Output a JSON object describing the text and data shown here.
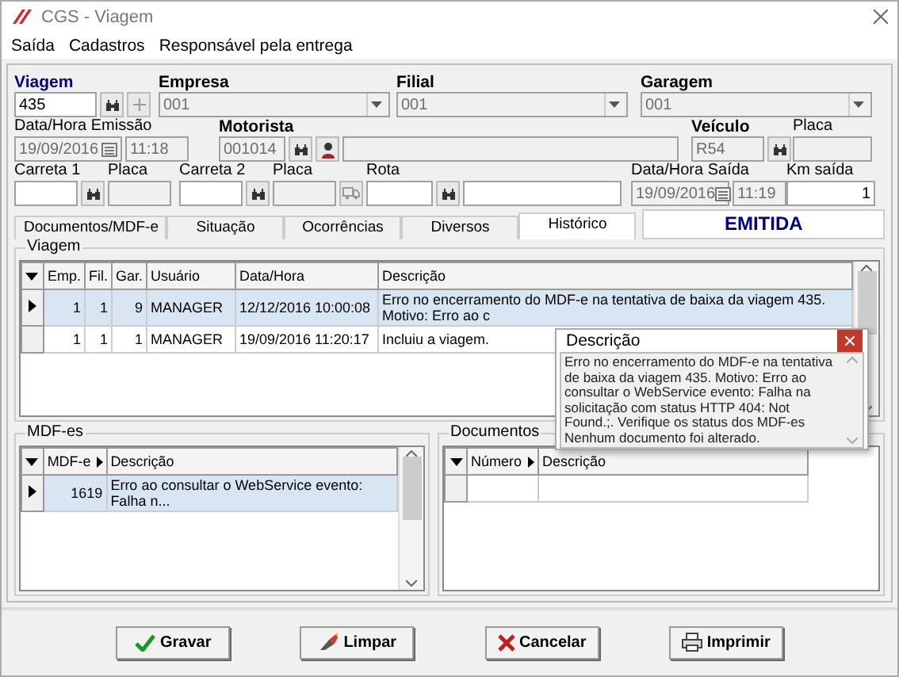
{
  "window": {
    "title": "CGS - Viagem"
  },
  "menu": [
    "Saída",
    "Cadastros",
    "Responsável pela entrega"
  ],
  "form": {
    "viagem": {
      "label": "Viagem",
      "value": "435",
      "disabled": false
    },
    "empresa": {
      "label": "Empresa",
      "value": "001",
      "disabled": true
    },
    "filial": {
      "label": "Filial",
      "value": "001",
      "disabled": true
    },
    "garagem": {
      "label": "Garagem",
      "value": "001",
      "disabled": true
    },
    "emissao": {
      "label": "Data/Hora Emissão",
      "date": "19/09/2016",
      "time": "11:18",
      "disabled": true
    },
    "motorista": {
      "label": "Motorista",
      "value": "001014",
      "disabled": true
    },
    "veiculo": {
      "label": "Veículo",
      "value": "R54",
      "disabled": true
    },
    "placa_veiculo": {
      "label": "Placa",
      "disabled": true
    },
    "carreta_1": {
      "label": "Carreta 1",
      "disabled": false
    },
    "placa_1": {
      "label": "Placa",
      "disabled": true
    },
    "carreta_2": {
      "label": "Carreta 2",
      "disabled": false
    },
    "placa_2": {
      "label": "Placa",
      "disabled": true
    },
    "rota": {
      "label": "Rota",
      "disabled": false
    },
    "saida": {
      "label": "Data/Hora Saída",
      "date": "19/09/2016",
      "time": "11:19",
      "disabled": true
    },
    "km_saida": {
      "label": "Km saída",
      "value": "1",
      "disabled": false
    }
  },
  "tabs": [
    {
      "label": "Documentos/MDF-e",
      "selected": false
    },
    {
      "label": "Situação",
      "selected": false
    },
    {
      "label": "Ocorrências",
      "selected": false
    },
    {
      "label": "Diversos",
      "selected": false
    },
    {
      "label": "Histórico",
      "selected": true
    }
  ],
  "status": "EMITIDA",
  "viagem_grid": {
    "title": "Viagem",
    "columns": [
      "Emp.",
      "Fil.",
      "Gar.",
      "Usuário",
      "Data/Hora",
      "Descrição"
    ],
    "rows": [
      {
        "cells": [
          "1",
          "1",
          "9",
          "MANAGER",
          "12/12/2016 10:00:08",
          "Erro no encerramento do MDF-e na tentativa de baixa da viagem 435. Motivo: Erro ao c"
        ],
        "selected": true
      },
      {
        "cells": [
          "1",
          "1",
          "1",
          "MANAGER",
          "19/09/2016 11:20:17",
          "Incluiu a viagem."
        ],
        "selected": false
      }
    ]
  },
  "mdfes": {
    "title": "MDF-es",
    "columns": [
      "MDF-e",
      "Descrição"
    ],
    "rows": [
      {
        "cells": [
          "1619",
          "Erro ao consultar o WebService evento: Falha n..."
        ],
        "selected": true
      }
    ]
  },
  "documentos": {
    "title": "Documentos",
    "columns": [
      "Número",
      "Descrição"
    ]
  },
  "popup": {
    "title": "Descrição",
    "text": "Erro no encerramento do MDF-e na tentativa de baixa da viagem 435. Motivo: Erro ao consultar o WebService evento: Falha na solicitação com status HTTP 404: Not Found.;. Verifique os status dos MDF-es Nenhum documento foi alterado."
  },
  "buttons": [
    {
      "label": "Gravar",
      "kind": "save"
    },
    {
      "label": "Limpar",
      "kind": "clear"
    },
    {
      "label": "Cancelar",
      "kind": "cancel"
    },
    {
      "label": "Imprimir",
      "kind": "print"
    }
  ]
}
